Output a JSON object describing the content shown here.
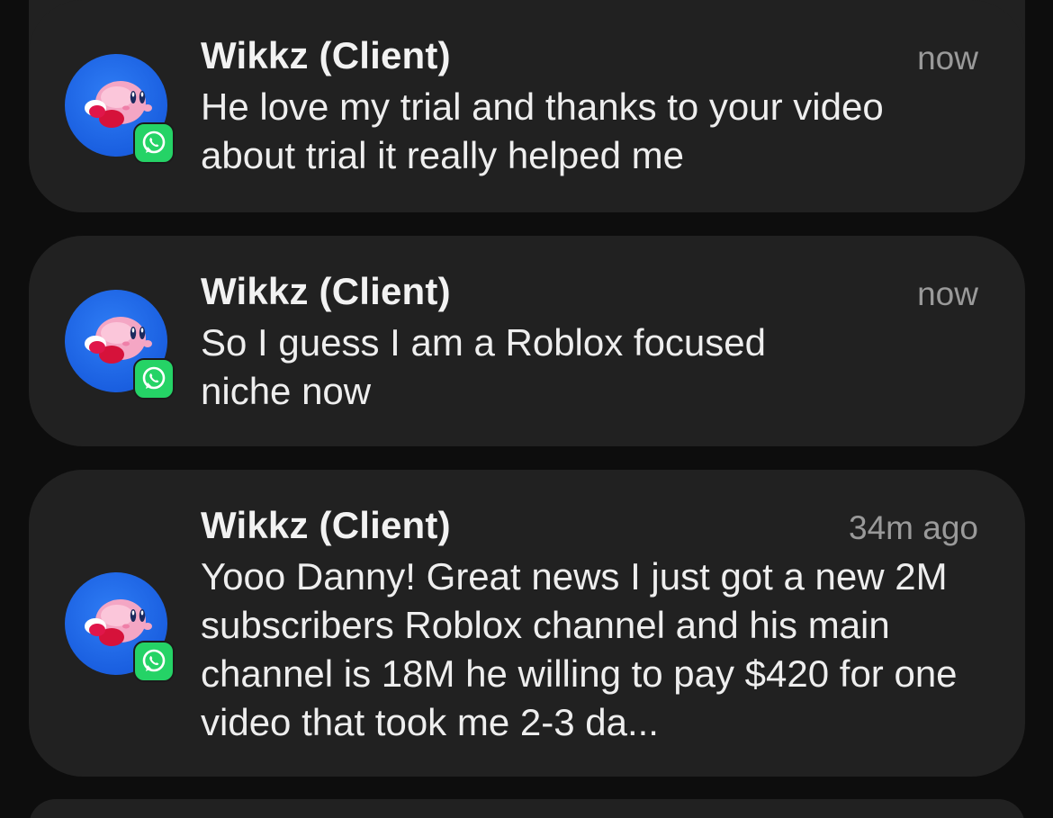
{
  "notifications": [
    {
      "sender": "Wikkz (Client)",
      "time": "now",
      "message": "He love my trial and thanks to your video about trial it really helped me",
      "app_badge_icon": "whatsapp-icon",
      "avatar_icon": "kirby-icon"
    },
    {
      "sender": "Wikkz (Client)",
      "time": "now",
      "message": "So I guess I am a Roblox focused niche now",
      "app_badge_icon": "whatsapp-icon",
      "avatar_icon": "kirby-icon"
    },
    {
      "sender": "Wikkz (Client)",
      "time": "34m ago",
      "message": "Yooo Danny! Great news I just got a new 2M subscribers Roblox channel and his main channel is 18M he willing to pay $420 for one video that took me 2-3 da...",
      "app_badge_icon": "whatsapp-icon",
      "avatar_icon": "kirby-icon"
    }
  ],
  "colors": {
    "background": "#0d0d0d",
    "card": "#212121",
    "avatar_blue": "#1a5fe0",
    "whatsapp_green": "#25d366"
  }
}
